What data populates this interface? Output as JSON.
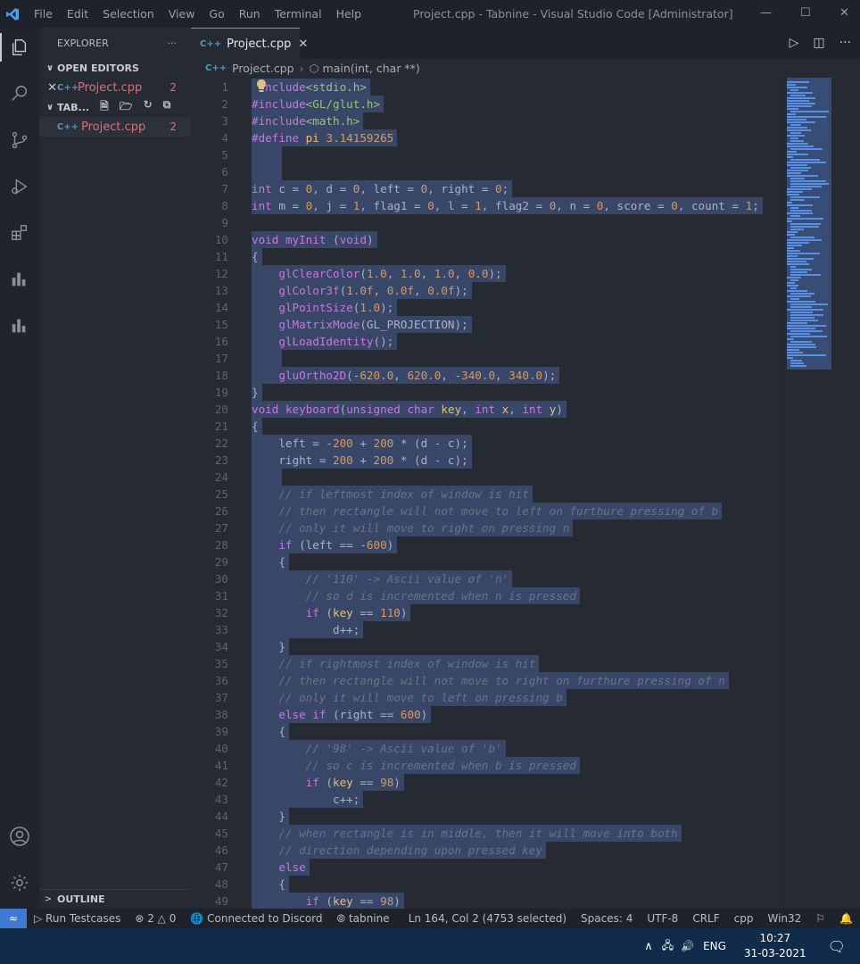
{
  "window": {
    "title": "Project.cpp - Tabnine - Visual Studio Code [Administrator]",
    "menu": [
      "File",
      "Edit",
      "Selection",
      "View",
      "Go",
      "Run",
      "Terminal",
      "Help"
    ]
  },
  "sidebar": {
    "title": "EXPLORER",
    "more": "···",
    "open_editors_label": "OPEN EDITORS",
    "workspace_label": "TAB...",
    "open_file": {
      "icon": "C++",
      "name": "Project.cpp",
      "problems": "2"
    },
    "tree_file": {
      "icon": "C++",
      "name": "Project.cpp",
      "problems": "2"
    },
    "outline_label": "OUTLINE"
  },
  "editor": {
    "tab_icon": "C++",
    "tab_label": "Project.cpp",
    "breadcrumb_file": "Project.cpp",
    "breadcrumb_symbol": "main(int, char **)"
  },
  "code_lines": [
    {
      "n": "1",
      "h": "<span class='wh'>  </span><span class='pp'>nclude</span><span class='st'>&lt;stdio.h&gt;</span>"
    },
    {
      "n": "2",
      "h": "<span class='pp'>#include</span><span class='st'>&lt;GL/glut.h&gt;</span>"
    },
    {
      "n": "3",
      "h": "<span class='pp'>#include</span><span class='st'>&lt;math.h&gt;</span>"
    },
    {
      "n": "4",
      "h": "<span class='pp'>#define</span> <span class='va'>pi</span> <span class='nu'>3.14159265</span>"
    },
    {
      "n": "5",
      "h": "    "
    },
    {
      "n": "6",
      "h": "    "
    },
    {
      "n": "7",
      "h": "<span class='kw'>int</span> c = <span class='nu'>0</span>, d = <span class='nu'>0</span>, left = <span class='nu'>0</span>, right = <span class='nu'>0</span>;"
    },
    {
      "n": "8",
      "h": "<span class='kw'>int</span> m = <span class='nu'>0</span>, j = <span class='nu'>1</span>, flag1 = <span class='nu'>0</span>, l = <span class='nu'>1</span>, flag2 = <span class='nu'>0</span>, n = <span class='nu'>0</span>, score = <span class='nu'>0</span>, count = <span class='nu'>1</span>;"
    },
    {
      "n": "9",
      "h": ""
    },
    {
      "n": "10",
      "h": "<span class='kw'>void</span> <span class='fn'>myInit</span> (<span class='kw'>void</span>)"
    },
    {
      "n": "11",
      "h": "{"
    },
    {
      "n": "12",
      "h": "    <span class='fn'>glClearColor</span>(<span class='nu'>1.0</span>, <span class='nu'>1.0</span>, <span class='nu'>1.0</span>, <span class='nu'>0.0</span>);"
    },
    {
      "n": "13",
      "h": "    <span class='fn'>glColor3f</span>(<span class='nu'>1.0f</span>, <span class='nu'>0.0f</span>, <span class='nu'>0.0f</span>);"
    },
    {
      "n": "14",
      "h": "    <span class='fn'>glPointSize</span>(<span class='nu'>1.0</span>);"
    },
    {
      "n": "15",
      "h": "    <span class='fn'>glMatrixMode</span>(GL_PROJECTION);"
    },
    {
      "n": "16",
      "h": "    <span class='fn'>glLoadIdentity</span>();"
    },
    {
      "n": "17",
      "h": "    "
    },
    {
      "n": "18",
      "h": "    <span class='fn'>gluOrtho2D</span>(-<span class='nu'>620.0</span>, <span class='nu'>620.0</span>, -<span class='nu'>340.0</span>, <span class='nu'>340.0</span>);"
    },
    {
      "n": "19",
      "h": "}"
    },
    {
      "n": "20",
      "h": "<span class='kw'>void</span> <span class='fn'>keyboard</span>(<span class='kw'>unsigned</span> <span class='kw'>char</span> <span class='va'>key</span>, <span class='kw'>int</span> <span class='va'>x</span>, <span class='kw'>int</span> <span class='va'>y</span>)"
    },
    {
      "n": "21",
      "h": "{"
    },
    {
      "n": "22",
      "h": "    left = -<span class='nu'>200</span> + <span class='nu'>200</span> * (d - c);"
    },
    {
      "n": "23",
      "h": "    right = <span class='nu'>200</span> + <span class='nu'>200</span> * (d - c);"
    },
    {
      "n": "24",
      "h": "    "
    },
    {
      "n": "25",
      "h": "    <span class='cm'>// if leftmost index of window is hit</span>"
    },
    {
      "n": "26",
      "h": "    <span class='cm'>// then rectangle will not move to left on furthure pressing of b</span>"
    },
    {
      "n": "27",
      "h": "    <span class='cm'>// only it will move to right on pressing n</span>"
    },
    {
      "n": "28",
      "h": "    <span class='kw'>if</span> (left == -<span class='nu'>600</span>)"
    },
    {
      "n": "29",
      "h": "    {"
    },
    {
      "n": "30",
      "h": "        <span class='cm'>// '110' -&gt; Ascii value of 'n'</span>"
    },
    {
      "n": "31",
      "h": "        <span class='cm'>// so d is incremented when n is pressed</span>"
    },
    {
      "n": "32",
      "h": "        <span class='kw'>if</span> (<span class='va'>key</span> == <span class='nu'>110</span>)"
    },
    {
      "n": "33",
      "h": "            d++;"
    },
    {
      "n": "34",
      "h": "    }"
    },
    {
      "n": "35",
      "h": "    <span class='cm'>// if rightmost index of window is hit</span>"
    },
    {
      "n": "36",
      "h": "    <span class='cm'>// then rectangle will not move to right on furthure pressing of n</span>"
    },
    {
      "n": "37",
      "h": "    <span class='cm'>// only it will move to left on pressing b</span>"
    },
    {
      "n": "38",
      "h": "    <span class='kw'>else</span> <span class='kw'>if</span> (right == <span class='nu'>600</span>)"
    },
    {
      "n": "39",
      "h": "    {"
    },
    {
      "n": "40",
      "h": "        <span class='cm'>// '98' -&gt; Ascii value of 'b'</span>"
    },
    {
      "n": "41",
      "h": "        <span class='cm'>// so c is incremented when b is pressed</span>"
    },
    {
      "n": "42",
      "h": "        <span class='kw'>if</span> (<span class='va'>key</span> == <span class='nu'>98</span>)"
    },
    {
      "n": "43",
      "h": "            c++;"
    },
    {
      "n": "44",
      "h": "    }"
    },
    {
      "n": "45",
      "h": "    <span class='cm'>// when rectangle is in middle, then it will move into both</span>"
    },
    {
      "n": "46",
      "h": "    <span class='cm'>// direction depending upon pressed key</span>"
    },
    {
      "n": "47",
      "h": "    <span class='kw'>else</span>"
    },
    {
      "n": "48",
      "h": "    {"
    },
    {
      "n": "49",
      "h": "        <span class='kw'>if</span> (<span class='va'>key</span> == <span class='nu'>98</span>)"
    }
  ],
  "statusbar": {
    "run_testcases": "Run Testcases",
    "errors": "2",
    "warnings": "0",
    "discord": "Connected to Discord",
    "tabnine": "tabnine",
    "position": "Ln 164, Col 2 (4753 selected)",
    "spaces": "Spaces: 4",
    "encoding": "UTF-8",
    "eol": "CRLF",
    "language": "cpp",
    "platform": "Win32"
  },
  "taskbar": {
    "lang": "ENG",
    "time": "10:27",
    "date": "31-03-2021"
  }
}
